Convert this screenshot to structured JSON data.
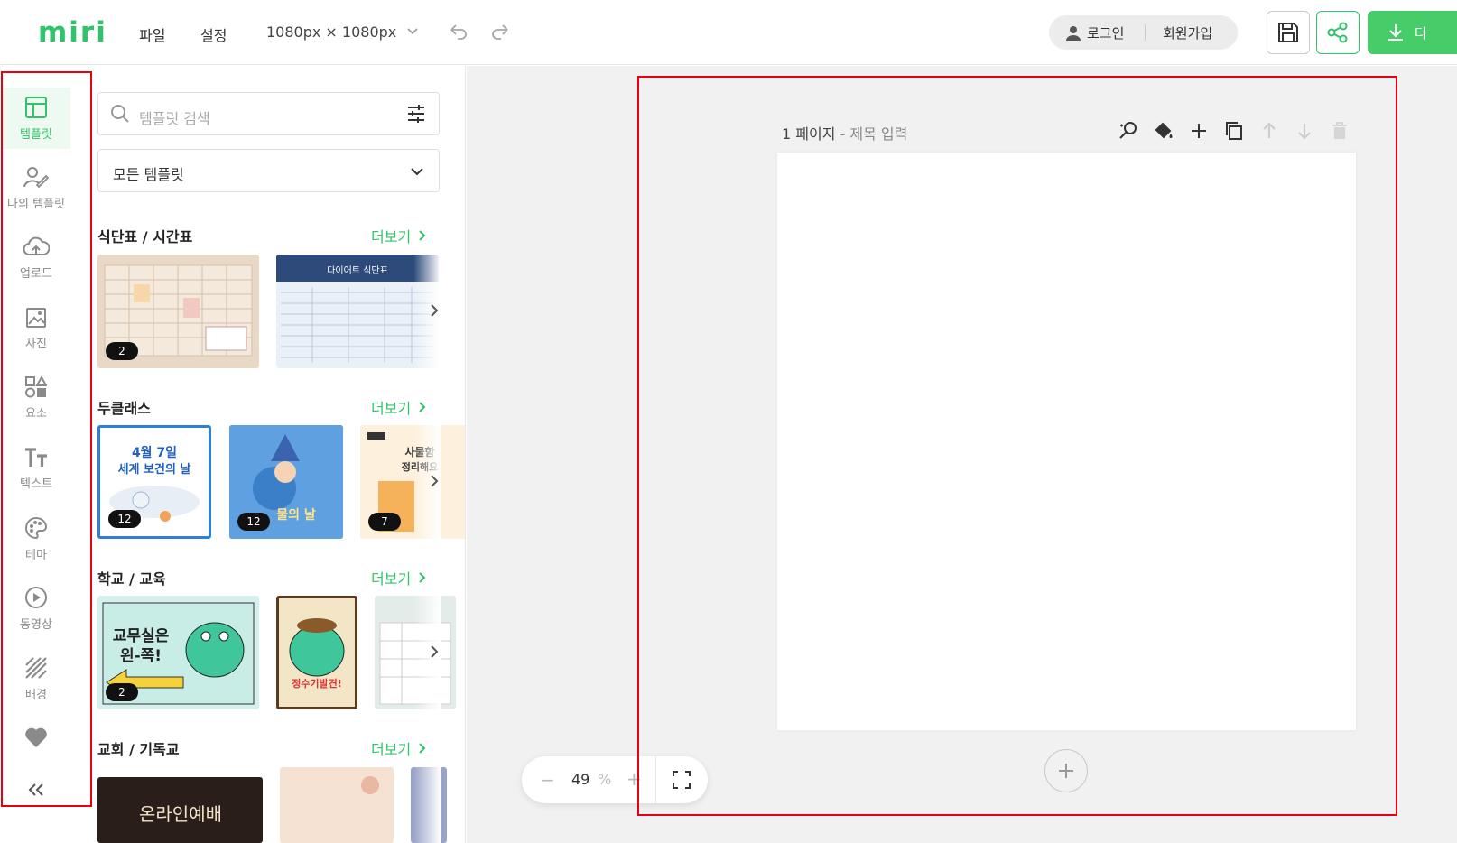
{
  "app": {
    "logo": "miri"
  },
  "topbar": {
    "menu_file": "파일",
    "menu_settings": "설정",
    "canvas_size": "1080px × 1080px",
    "login": "로그인",
    "signup": "회원가입",
    "download_label": "다",
    "accent": "#2fc36a",
    "download_color": "#46cc68"
  },
  "sidebar": {
    "items": [
      {
        "label": "템플릿",
        "icon": "template-icon"
      },
      {
        "label": "나의 템플릿",
        "icon": "my-template-icon"
      },
      {
        "label": "업로드",
        "icon": "upload-cloud-icon"
      },
      {
        "label": "사진",
        "icon": "photo-icon"
      },
      {
        "label": "요소",
        "icon": "shapes-icon"
      },
      {
        "label": "텍스트",
        "icon": "text-icon"
      },
      {
        "label": "테마",
        "icon": "palette-icon"
      },
      {
        "label": "동영상",
        "icon": "play-icon"
      },
      {
        "label": "배경",
        "icon": "background-icon"
      },
      {
        "label": "",
        "icon": "heart-icon"
      }
    ]
  },
  "panel": {
    "search_placeholder": "템플릿 검색",
    "filter_value": "모든 템플릿",
    "sections": [
      {
        "title": "식단표 / 시간표",
        "more": "더보기",
        "badges": [
          "2",
          "",
          ""
        ]
      },
      {
        "title": "두클래스",
        "more": "더보기",
        "badges": [
          "12",
          "12",
          "7"
        ]
      },
      {
        "title": "학교 / 교육",
        "more": "더보기",
        "badges": [
          "2",
          "",
          ""
        ]
      },
      {
        "title": "교회 / 기독교",
        "more": "더보기",
        "badges": [
          "",
          "",
          ""
        ]
      }
    ],
    "thumb_texts": {
      "t1b_title": "다이어트 식단표",
      "t2a_line1": "4월 7일",
      "t2a_line2": "세계 보건의 날",
      "t2b_title": "물의 날",
      "t2c_line1": "사물함",
      "t2c_line2": "정리해요",
      "t3a_line1": "교무실은",
      "t3a_line2": "왼-쪽!",
      "t3b_title": "정수기발견!",
      "t4a_title": "온라인예배"
    }
  },
  "editor": {
    "page_label": "1 페이지",
    "title_placeholder": " - 제목 입력",
    "zoom_value": "49",
    "zoom_unit": "%"
  }
}
